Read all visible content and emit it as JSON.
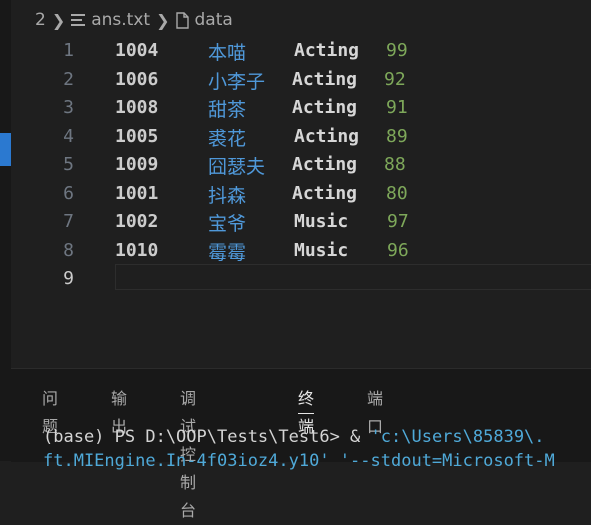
{
  "breadcrumb": {
    "prefix": "2",
    "file": "ans.txt",
    "section": "data"
  },
  "lines": [
    {
      "num": "1",
      "id": "1004",
      "name": "本喵",
      "cat": "Acting",
      "score": "99"
    },
    {
      "num": "2",
      "id": "1006",
      "name": "小李子",
      "cat": "Acting",
      "score": "92"
    },
    {
      "num": "3",
      "id": "1008",
      "name": "甜茶",
      "cat": "Acting",
      "score": "91"
    },
    {
      "num": "4",
      "id": "1005",
      "name": "裘花",
      "cat": "Acting",
      "score": "89"
    },
    {
      "num": "5",
      "id": "1009",
      "name": "囧瑟夫",
      "cat": "Acting",
      "score": "88"
    },
    {
      "num": "6",
      "id": "1001",
      "name": "抖森",
      "cat": "Acting",
      "score": "80"
    },
    {
      "num": "7",
      "id": "1002",
      "name": "宝爷",
      "cat": "Music",
      "score": "97"
    },
    {
      "num": "8",
      "id": "1010",
      "name": "霉霉",
      "cat": "Music",
      "score": "96"
    },
    {
      "num": "9",
      "id": "",
      "name": "",
      "cat": "",
      "score": ""
    }
  ],
  "panel": {
    "tabs": [
      "问题",
      "输出",
      "调试控制台",
      "终端",
      "端口"
    ],
    "active_tab": "终端",
    "terminal": {
      "prompt": "(base) PS D:\\OOP\\Tests\\Test6> ",
      "cmd": " & ",
      "path": "'c:\\Users\\85839\\.",
      "line2": "ft.MIEngine.In-4f03ioz4.y10' '--stdout=Microsoft-M"
    }
  },
  "colors": {
    "accent": "#2b79d0",
    "name": "#4f98d9",
    "number": "#7ea85a"
  }
}
